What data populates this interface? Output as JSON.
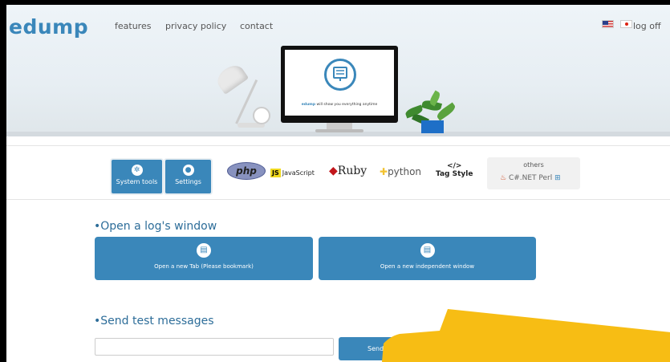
{
  "header": {
    "logo": "edump",
    "nav": [
      "features",
      "privacy policy",
      "contact"
    ],
    "log_off": "log off"
  },
  "hero": {
    "tagline_brand": "edump",
    "tagline_rest": " will show you everything anytime"
  },
  "toolbar": {
    "system_tools": "System tools",
    "settings": "Settings",
    "languages": {
      "php": "php",
      "javascript": "JavaScript",
      "js_badge": "JS",
      "ruby": "Ruby",
      "python": "python",
      "tag_symbol": "</>",
      "tag_style": "Tag Style"
    },
    "others": {
      "label": "others",
      "items": "C#.NET  Perl"
    }
  },
  "log_window": {
    "title": "•Open a log's window",
    "new_tab": "Open a new Tab (Please bookmark)",
    "new_window": "Open a new independent window"
  },
  "test_messages": {
    "title": "•Send test messages",
    "input_value": "",
    "send": "Send"
  },
  "colors": {
    "accent": "#3a87ba",
    "overlay": "#f7bd14"
  }
}
